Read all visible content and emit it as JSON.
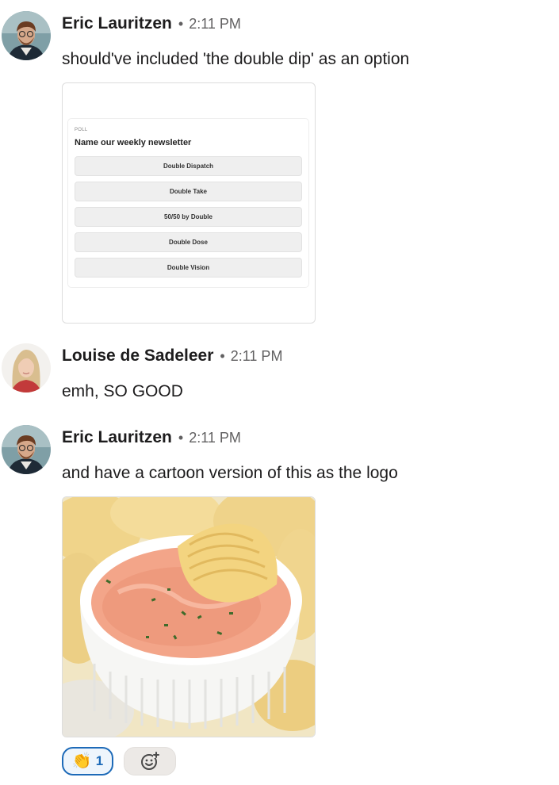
{
  "messages": [
    {
      "author": "Eric Lauritzen",
      "separator": "•",
      "time": "2:11 PM",
      "text": "should've included 'the double dip' as an option",
      "poll": {
        "kicker": "POLL",
        "title": "Name our weekly newsletter",
        "options": [
          "Double Dispatch",
          "Double Take",
          "50/50 by Double",
          "Double Dose",
          "Double Vision"
        ]
      }
    },
    {
      "author": "Louise de Sadeleer",
      "separator": "•",
      "time": "2:11 PM",
      "text": "emh, SO GOOD"
    },
    {
      "author": "Eric Lauritzen",
      "separator": "•",
      "time": "2:11 PM",
      "text": "and have a cartoon version of this as the logo"
    }
  ],
  "reactions": [
    {
      "emoji": "👏",
      "icon": "clapping-hands-icon",
      "count": "1",
      "selected": true
    }
  ],
  "add_reaction": {
    "icon": "add-emoji-icon"
  },
  "colors": {
    "accent": "#1d6ab8",
    "text": "#1d1c1d",
    "muted": "#616061"
  }
}
